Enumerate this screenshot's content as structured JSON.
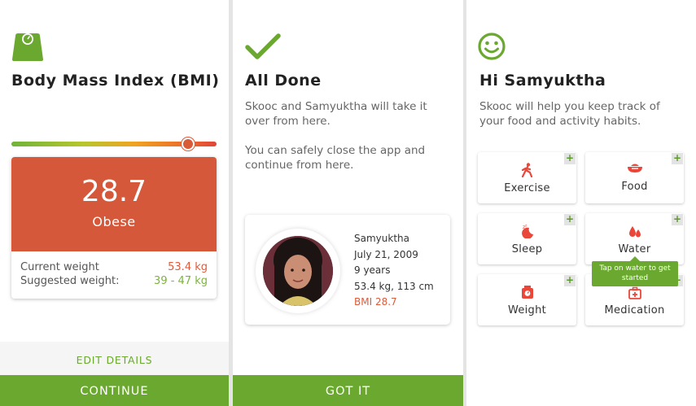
{
  "colors": {
    "accent_green": "#6aa82f",
    "bmi_orange": "#d6583a"
  },
  "bmi_screen": {
    "icon": "weighing-scale-icon",
    "title": "Body Mass Index (BMI)",
    "bmi_scale_position": 0.86,
    "bmi_value": "28.7",
    "bmi_category": "Obese",
    "current_weight_label": "Current weight",
    "current_weight_value": "53.4 kg",
    "suggested_weight_label": "Suggested weight:",
    "suggested_weight_value": "39 - 47 kg",
    "edit_label": "EDIT DETAILS",
    "continue_label": "CONTINUE"
  },
  "done_screen": {
    "icon": "checkmark-icon",
    "title": "All Done",
    "message_1": "Skooc and Samyuktha will take it over from here.",
    "message_2": "You can safely close the app and continue from here.",
    "profile": {
      "name": "Samyuktha",
      "dob": "July 21, 2009",
      "age": "9 years",
      "measurements": "53.4 kg, 113 cm",
      "bmi": "BMI 28.7"
    },
    "got_it_label": "GOT IT"
  },
  "home_screen": {
    "icon": "smiley-icon",
    "title": "Hi Samyuktha",
    "message": "Skooc will help you keep track of your food and activity habits.",
    "tiles": [
      {
        "label": "Exercise",
        "icon": "running-person-icon"
      },
      {
        "label": "Food",
        "icon": "food-bowl-icon"
      },
      {
        "label": "Sleep",
        "icon": "sleep-moon-icon"
      },
      {
        "label": "Water",
        "icon": "water-drops-icon"
      },
      {
        "label": "Weight",
        "icon": "weighing-scale-icon"
      },
      {
        "label": "Medication",
        "icon": "medical-kit-icon"
      }
    ],
    "plus_symbol": "+",
    "tooltip": "Tap on water to get started"
  }
}
